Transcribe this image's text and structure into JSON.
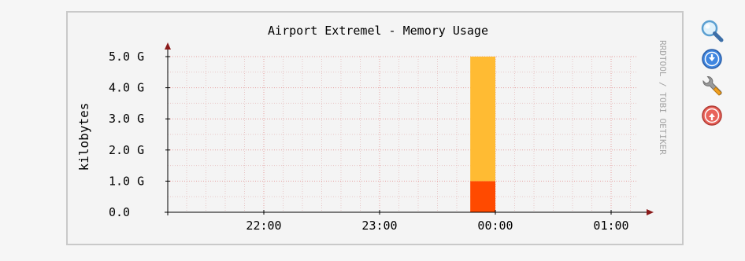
{
  "chart_data": {
    "type": "bar",
    "title": "Airport Extremel - Memory Usage",
    "ylabel": "kilobytes",
    "watermark": "RRDTOOL / TOBI OETIKER",
    "ylim": [
      0,
      5.0
    ],
    "y_unit": "G",
    "y_ticks": [
      "0.0",
      "1.0 G",
      "2.0 G",
      "3.0 G",
      "4.0 G",
      "5.0 G"
    ],
    "x_ticks": [
      "22:00",
      "23:00",
      "00:00",
      "01:00"
    ],
    "grid": true,
    "bars": [
      {
        "time": "23:47-00:00",
        "segments": [
          {
            "value": 1.0,
            "color": "#ff4a00"
          },
          {
            "value": 4.0,
            "color": "#ffbb33"
          }
        ]
      }
    ]
  },
  "colors": {
    "grid_major": "#e6a0a0",
    "grid_minor": "#e8c8c8",
    "axis": "#8b1a1a",
    "watermark": "#a6a6a6"
  },
  "icons": [
    {
      "name": "zoom-icon",
      "label": "zoom"
    },
    {
      "name": "download-icon",
      "label": "download"
    },
    {
      "name": "wrench-icon",
      "label": "settings"
    },
    {
      "name": "upload-icon",
      "label": "upload"
    }
  ]
}
